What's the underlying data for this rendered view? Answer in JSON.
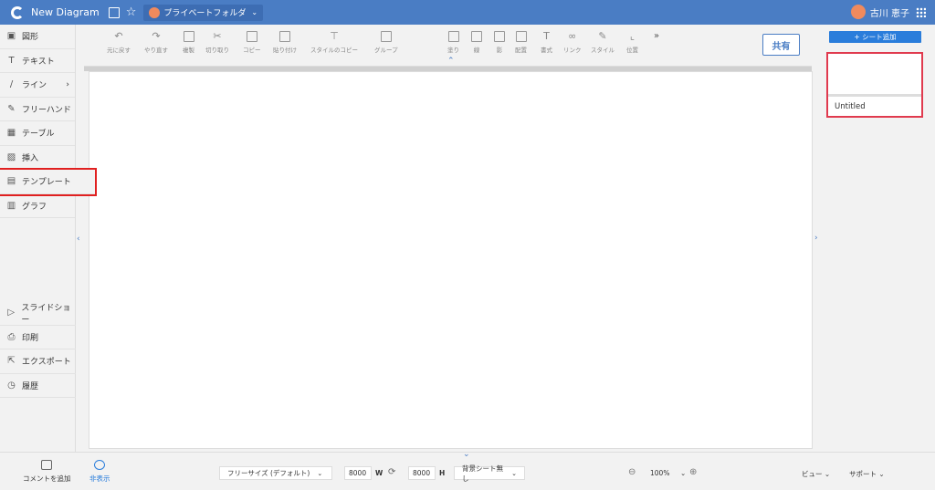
{
  "topbar": {
    "app_title": "New Diagram",
    "folder_label": "プライベートフォルダ",
    "user_name": "古川 恵子"
  },
  "sidebar": {
    "items": [
      {
        "label": "図形",
        "icon": "shapes-icon"
      },
      {
        "label": "テキスト",
        "icon": "text-icon"
      },
      {
        "label": "ライン",
        "icon": "line-icon"
      },
      {
        "label": "フリーハンド",
        "icon": "pencil-icon"
      },
      {
        "label": "テーブル",
        "icon": "table-icon"
      },
      {
        "label": "挿入",
        "icon": "image-insert-icon"
      },
      {
        "label": "テンプレート",
        "icon": "template-icon"
      },
      {
        "label": "グラフ",
        "icon": "chart-icon"
      }
    ],
    "bottom_items": [
      {
        "label": "スライドショー",
        "icon": "play-icon"
      },
      {
        "label": "印刷",
        "icon": "print-icon"
      },
      {
        "label": "エクスポート",
        "icon": "export-icon"
      },
      {
        "label": "履歴",
        "icon": "history-icon"
      }
    ]
  },
  "toolbar": {
    "undo": "元に戻す",
    "redo": "やり直す",
    "duplicate": "複製",
    "cut": "切り取り",
    "copy": "コピー",
    "paste": "貼り付け",
    "style_copy": "スタイルのコピー",
    "group": "グループ",
    "fill": "塗り",
    "line": "線",
    "shadow": "影",
    "arrange": "配置",
    "format": "書式",
    "link": "リンク",
    "style": "スタイル",
    "position": "位置",
    "more": "»",
    "share_label": "共有"
  },
  "right_panel": {
    "add_sheet_label": "+ シート追加",
    "sheet_name": "Untitled"
  },
  "footer": {
    "add_comment": "コメントを追加",
    "hide": "非表示",
    "page_size": "フリーサイズ (デフォルト)",
    "width_value": "8000",
    "width_label": "W",
    "height_value": "8000",
    "height_label": "H",
    "background": "背景シート無し",
    "zoom": "100%",
    "view": "ビュー",
    "support": "サポート"
  },
  "colors": {
    "topbar": "#4a7dc4",
    "accent": "#2a7ddb",
    "highlight": "#e02020"
  }
}
